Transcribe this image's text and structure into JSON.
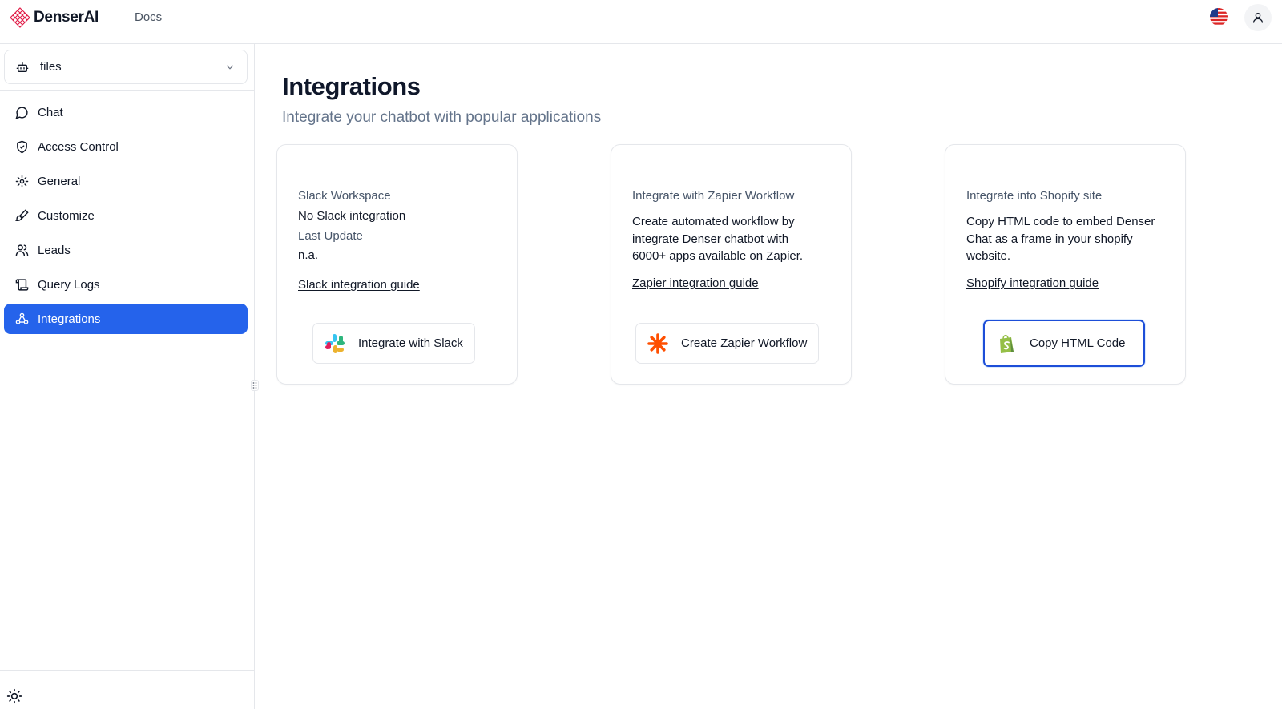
{
  "header": {
    "brand": "DenserAI",
    "docs_label": "Docs"
  },
  "sidebar": {
    "bot_selector": "files",
    "items": [
      {
        "label": "Chat",
        "icon": "chat-bubble-icon"
      },
      {
        "label": "Access Control",
        "icon": "shield-icon"
      },
      {
        "label": "General",
        "icon": "gear-icon"
      },
      {
        "label": "Customize",
        "icon": "brush-icon"
      },
      {
        "label": "Leads",
        "icon": "users-icon"
      },
      {
        "label": "Query Logs",
        "icon": "scroll-icon"
      },
      {
        "label": "Integrations",
        "icon": "integrations-icon",
        "active": true
      }
    ]
  },
  "main": {
    "title": "Integrations",
    "subtitle": "Integrate your chatbot with popular applications",
    "cards": {
      "slack": {
        "workspace_label": "Slack Workspace",
        "workspace_value": "No Slack integration",
        "last_update_label": "Last Update",
        "last_update_value": "n.a.",
        "guide": "Slack integration guide",
        "button": "Integrate with Slack"
      },
      "zapier": {
        "heading": "Integrate with Zapier Workflow",
        "description": "Create automated workflow by integrate Denser chatbot with 6000+ apps available on Zapier.",
        "guide": "Zapier integration guide",
        "button": "Create Zapier Workflow"
      },
      "shopify": {
        "heading": "Integrate into Shopify site",
        "description": "Copy HTML code to embed Denser Chat as a frame in your shopify website.",
        "guide": "Shopify integration guide",
        "button": "Copy HTML Code"
      }
    }
  },
  "colors": {
    "accent": "#2563eb",
    "zapier": "#ff4f00",
    "shopify": "#95bf47"
  }
}
